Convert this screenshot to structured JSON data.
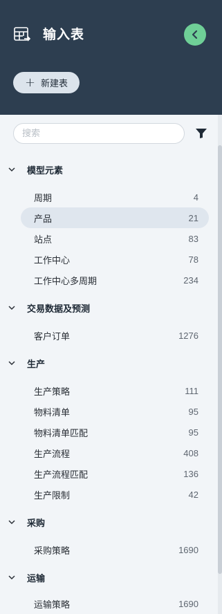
{
  "header": {
    "title": "输入表",
    "app_icon": "table-input-icon",
    "collapse_icon": "chevron-left-icon",
    "new_button_label": "新建表",
    "accent_color": "#6fcf97",
    "background_color": "#2d3e50"
  },
  "search": {
    "placeholder": "搜索",
    "filter_icon": "filter-funnel-icon"
  },
  "groups": [
    {
      "label": "模型元素",
      "items": [
        {
          "label": "周期",
          "count": "4"
        },
        {
          "label": "产品",
          "count": "21",
          "selected": true
        },
        {
          "label": "站点",
          "count": "83"
        },
        {
          "label": "工作中心",
          "count": "78"
        },
        {
          "label": "工作中心多周期",
          "count": "234"
        }
      ]
    },
    {
      "label": "交易数据及预测",
      "items": [
        {
          "label": "客户订单",
          "count": "1276"
        }
      ]
    },
    {
      "label": "生产",
      "items": [
        {
          "label": "生产策略",
          "count": "111"
        },
        {
          "label": "物料清单",
          "count": "95"
        },
        {
          "label": "物料清单匹配",
          "count": "95"
        },
        {
          "label": "生产流程",
          "count": "408"
        },
        {
          "label": "生产流程匹配",
          "count": "136"
        },
        {
          "label": "生产限制",
          "count": "42"
        }
      ]
    },
    {
      "label": "采购",
      "items": [
        {
          "label": "采购策略",
          "count": "1690"
        }
      ]
    },
    {
      "label": "运输",
      "items": [
        {
          "label": "运输策略",
          "count": "1690"
        }
      ]
    }
  ]
}
